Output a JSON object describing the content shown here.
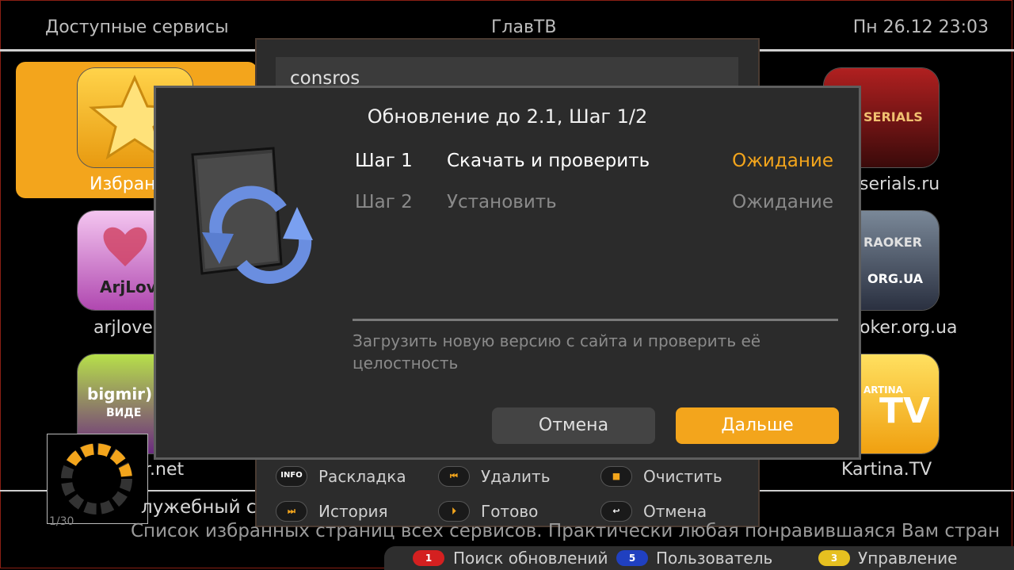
{
  "header": {
    "left": "Доступные сервисы",
    "center": "ГлавТВ",
    "datetime": "Пн 26.12 23:03"
  },
  "services": {
    "favorites": "Избран",
    "arjlover": "arjlover",
    "bigmir": "r.net",
    "serials": "serials.ru",
    "karaoker": "oker.org.ua",
    "kartina": "Kartina.TV",
    "icon_texts": {
      "arjlover": "ArjLov",
      "bigmir": "bigmir)",
      "bigmir_sub": "ВИДЕ",
      "serials": "SERIALS",
      "karaoker": "RAOKER",
      "karaoker_sub": "ORG.UA",
      "kartina": "ARTINA",
      "kartina_sub": "TV"
    }
  },
  "keyboard_panel": {
    "input_value": "consros",
    "actions": [
      {
        "badge": "INFO",
        "label": "Раскладка"
      },
      {
        "badge": "⏮",
        "label": "Удалить"
      },
      {
        "badge": "■",
        "label": "Очистить"
      },
      {
        "badge": "⏭",
        "label": "История"
      },
      {
        "badge": "⏵",
        "label": "Готово"
      },
      {
        "badge": "↩",
        "label": "Отмена"
      }
    ]
  },
  "dialog": {
    "title": "Обновление до 2.1, Шаг 1/2",
    "steps": [
      {
        "name": "Шаг 1",
        "action": "Скачать и проверить",
        "status": "Ожидание"
      },
      {
        "name": "Шаг 2",
        "action": "Установить",
        "status": "Ожидание"
      }
    ],
    "description": "Загрузить новую версию с сайта и проверить её целостность",
    "cancel_label": "Отмена",
    "next_label": "Дальше"
  },
  "status": {
    "service_title": "лужебный с",
    "count": "1/30",
    "description": "Список избранных страниц всех сервисов. Практически любая понравившаяся Вам стран"
  },
  "footer": [
    {
      "badge": "1",
      "label": "Поиск обновлений",
      "color": "#d42020"
    },
    {
      "badge": "5",
      "label": "Пользователь",
      "color": "#2040c0"
    },
    {
      "badge": "3",
      "label": "Управление",
      "color": "#e6c020"
    }
  ],
  "colors": {
    "accent": "#f3a51c",
    "background": "#000000",
    "dialog": "#2b2b2b"
  }
}
